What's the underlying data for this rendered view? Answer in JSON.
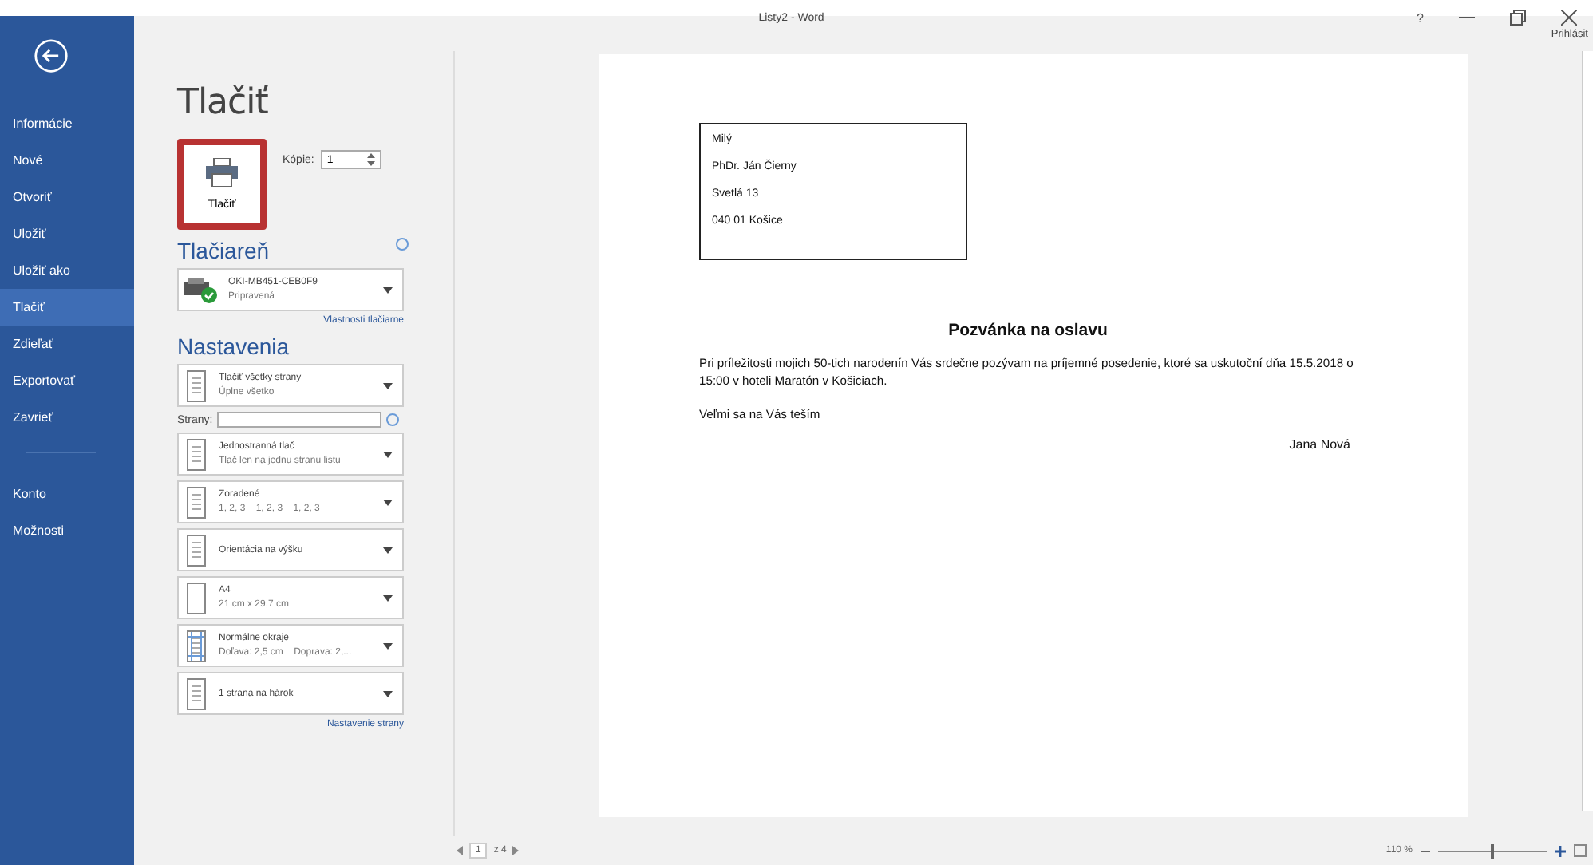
{
  "window": {
    "title": "Listy2 - Word",
    "help": "?",
    "account": "Prihlásit"
  },
  "sidebar": {
    "items": [
      {
        "label": "Informácie",
        "selected": false
      },
      {
        "label": "Nové",
        "selected": false
      },
      {
        "label": "Otvoriť",
        "selected": false
      },
      {
        "label": "Uložiť",
        "selected": false
      },
      {
        "label": "Uložiť ako",
        "selected": false
      },
      {
        "label": "Tlačiť",
        "selected": true
      },
      {
        "label": "Zdieľať",
        "selected": false
      },
      {
        "label": "Exportovať",
        "selected": false
      },
      {
        "label": "Zavrieť",
        "selected": false
      }
    ],
    "bottom_items": [
      {
        "label": "Konto",
        "selected": false
      },
      {
        "label": "Možnosti",
        "selected": false
      }
    ]
  },
  "page_title": "Tlačiť",
  "print_button": {
    "label": "Tlačiť"
  },
  "copies": {
    "label": "Kópie:",
    "value": "1"
  },
  "printer": {
    "heading": "Tlačiareň",
    "name": "OKI-MB451-CEB0F9",
    "status": "Pripravená",
    "link": "Vlastnosti tlačiarne"
  },
  "settings": {
    "heading": "Nastavenia",
    "items": [
      {
        "kind": "dropdown",
        "title": "Tlačiť všetky strany",
        "subtitle": "Úplne všetko"
      },
      {
        "kind": "field",
        "label": "Strany:"
      },
      {
        "kind": "dropdown",
        "title": "Jednostranná tlač",
        "subtitle": "Tlač len na jednu stranu listu"
      },
      {
        "kind": "dropdown",
        "title": "Zoradené",
        "subtitle": "1, 2, 3    1, 2, 3    1, 2, 3"
      },
      {
        "kind": "dropdown",
        "title": "Orientácia na výšku"
      },
      {
        "kind": "dropdown",
        "title": "A4",
        "subtitle": "21 cm x 29,7 cm"
      },
      {
        "kind": "dropdown",
        "title": "Normálne okraje",
        "subtitle": "Doľava: 2,5 cm    Doprava: 2,..."
      },
      {
        "kind": "dropdown",
        "title": "1 strana na hárok"
      }
    ],
    "link": "Nastavenie strany"
  },
  "document": {
    "address": [
      "Milý",
      "PhDr. Ján Čierny",
      "Svetlá 13",
      "040 01  Košice"
    ],
    "heading": "Pozvánka na oslavu",
    "paragraph": "Pri príležitosti mojich 50-tich narodenín Vás srdečne pozývam na príjemné posedenie, ktoré sa uskutoční dňa 15.5.2018 o 15:00 v hoteli Maratón v Košiciach.",
    "closing": "Veľmi sa na Vás teším",
    "signature": "Jana Nová"
  },
  "page_nav": {
    "current": "1",
    "total": "z 4"
  },
  "zoom": {
    "label": "110 %",
    "level": 0.5
  }
}
